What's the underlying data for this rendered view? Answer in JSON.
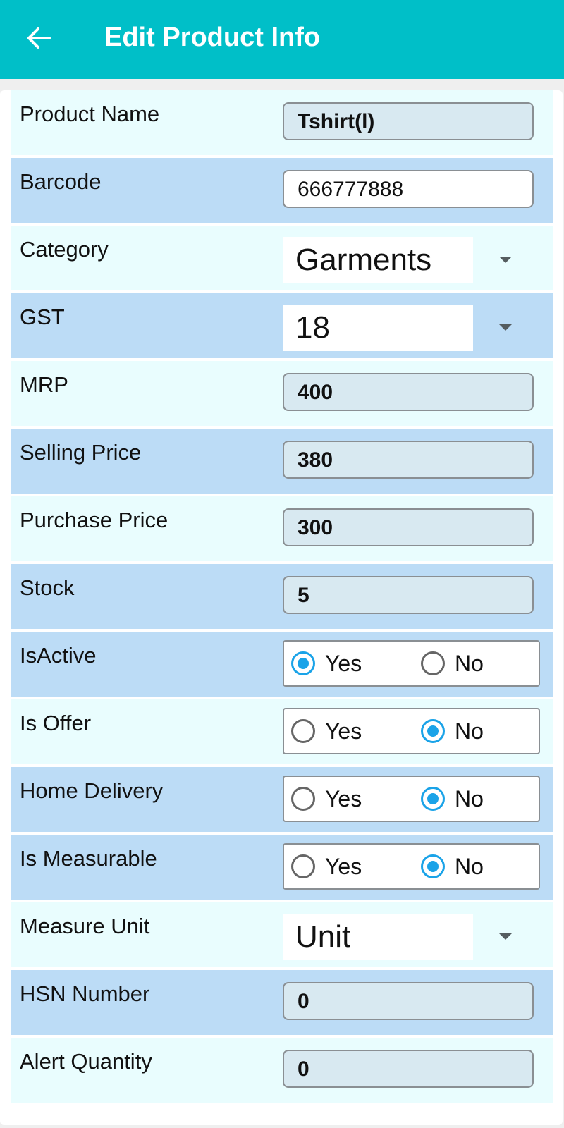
{
  "appbar": {
    "title": "Edit Product Info",
    "back_icon": "arrow-left-icon",
    "background": "#00bfc8"
  },
  "colors": {
    "row_light": "#e9fdfe",
    "row_dark": "#bcdcf6",
    "radio_accent": "#1aa3e8"
  },
  "fields": {
    "product_name": {
      "label": "Product Name",
      "value": "Tshirt(l)"
    },
    "barcode": {
      "label": "Barcode",
      "value": "666777888"
    },
    "category": {
      "label": "Category",
      "selected": "Garments"
    },
    "gst": {
      "label": "GST",
      "selected": "18"
    },
    "mrp": {
      "label": "MRP",
      "value": "400"
    },
    "selling_price": {
      "label": "Selling Price",
      "value": "380"
    },
    "purchase_price": {
      "label": "Purchase Price",
      "value": "300"
    },
    "stock": {
      "label": "Stock",
      "value": "5"
    },
    "is_active": {
      "label": "IsActive",
      "yes_label": "Yes",
      "no_label": "No",
      "selected": "Yes"
    },
    "is_offer": {
      "label": "Is Offer",
      "yes_label": "Yes",
      "no_label": "No",
      "selected": "No"
    },
    "home_delivery": {
      "label": "Home Delivery",
      "yes_label": "Yes",
      "no_label": "No",
      "selected": "No"
    },
    "is_measurable": {
      "label": "Is Measurable",
      "yes_label": "Yes",
      "no_label": "No",
      "selected": "No"
    },
    "measure_unit": {
      "label": "Measure Unit",
      "selected": "Unit"
    },
    "hsn_number": {
      "label": "HSN Number",
      "value": "0"
    },
    "alert_quantity": {
      "label": "Alert Quantity",
      "value": "0"
    }
  }
}
